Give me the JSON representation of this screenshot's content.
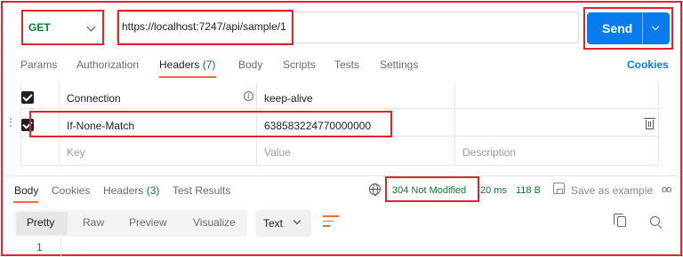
{
  "request": {
    "method": "GET",
    "url": "https://localhost:7247/api/sample/1",
    "send_label": "Send"
  },
  "request_tabs": {
    "params": "Params",
    "authorization": "Authorization",
    "headers": "Headers",
    "headers_count": "(7)",
    "body": "Body",
    "scripts": "Scripts",
    "tests": "Tests",
    "settings": "Settings",
    "cookies": "Cookies"
  },
  "headers_table": {
    "rows": [
      {
        "key": "Connection",
        "value": "keep-alive",
        "checked": true
      },
      {
        "key": "If-None-Match",
        "value": "638583224770000000",
        "checked": true
      }
    ],
    "placeholder_key": "Key",
    "placeholder_value": "Value",
    "placeholder_description": "Description"
  },
  "response_tabs": {
    "body": "Body",
    "cookies": "Cookies",
    "headers": "Headers",
    "headers_count": "(3)",
    "test_results": "Test Results"
  },
  "response_meta": {
    "status": "304 Not Modified",
    "time": "20 ms",
    "size": "118 B",
    "save_example": "Save as example",
    "more": "oo"
  },
  "body_toolbar": {
    "pretty": "Pretty",
    "raw": "Raw",
    "preview": "Preview",
    "visualize": "Visualize",
    "format": "Text"
  },
  "editor": {
    "line_number": "1"
  },
  "colors": {
    "accent": "#097bed",
    "success": "#0c7b2f",
    "tab_indicator": "#f26b3a",
    "highlight": "#e3232b"
  }
}
